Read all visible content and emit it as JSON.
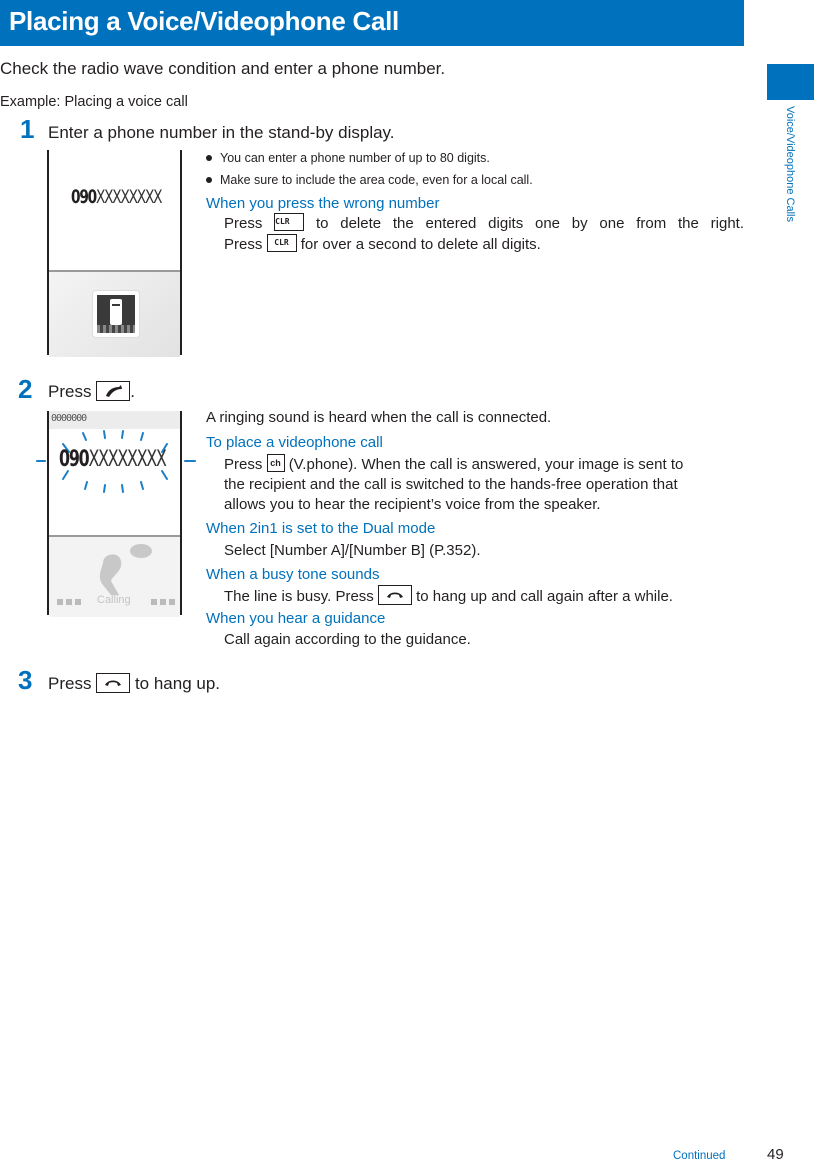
{
  "header": {
    "title": "Placing a Voice/Videophone Call"
  },
  "intro": "Check the radio wave condition and enter a phone number.",
  "example": "Example: Placing a voice call",
  "side_tab": {
    "label": "Voice/Videophone Calls",
    "accent_color": "#0071bc"
  },
  "steps": [
    {
      "number": "1",
      "text": "Enter a phone number in the stand-by display.",
      "screen": {
        "number_prefix": "090",
        "number_masked": "XXXXXXXX",
        "icon": "phone-handset-icon"
      },
      "bullets": [
        "You can enter a phone number of up to 80 digits.",
        "Make sure to include the area code, even for a local call."
      ],
      "notes": [
        {
          "heading": "When you press the wrong number",
          "line1_pre": "Press",
          "line1_key": "CLR",
          "line1_post": "to delete the entered digits one by one from the right.",
          "line2_pre": "Press",
          "line2_key": "CLR",
          "line2_post": "for over a second to delete all digits."
        }
      ]
    },
    {
      "number": "2",
      "text_pre": "Press",
      "text_key": "send-call-key",
      "text_post": ".",
      "screen": {
        "status_bar": "0000000",
        "number_prefix": "090",
        "number_masked": "XXXXXXXX",
        "calling_label": "Calling"
      },
      "lead": "A ringing sound is heard when the call is connected.",
      "notes": [
        {
          "heading": "To place a videophone call",
          "pre": "Press",
          "key": "ch",
          "post_line1": "(V.phone). When the call is answered, your image is sent to",
          "line2": "the recipient and the call is switched to the hands-free operation that",
          "line3": "allows you to hear the recipient’s voice from the speaker."
        },
        {
          "heading": "When 2in1 is set to the Dual mode",
          "body": "Select [Number A]/[Number B] (P.352)."
        },
        {
          "heading": "When a busy tone sounds",
          "pre": "The line is busy. Press",
          "key": "end-call-key",
          "post": "to hang up and call again after a while."
        },
        {
          "heading": "When you hear a guidance",
          "body": "Call again according to the guidance."
        }
      ]
    },
    {
      "number": "3",
      "text_pre": "Press",
      "text_key": "end-call-key",
      "text_post": "to hang up."
    }
  ],
  "footer": {
    "continued": "Continued",
    "page_number": "49"
  }
}
